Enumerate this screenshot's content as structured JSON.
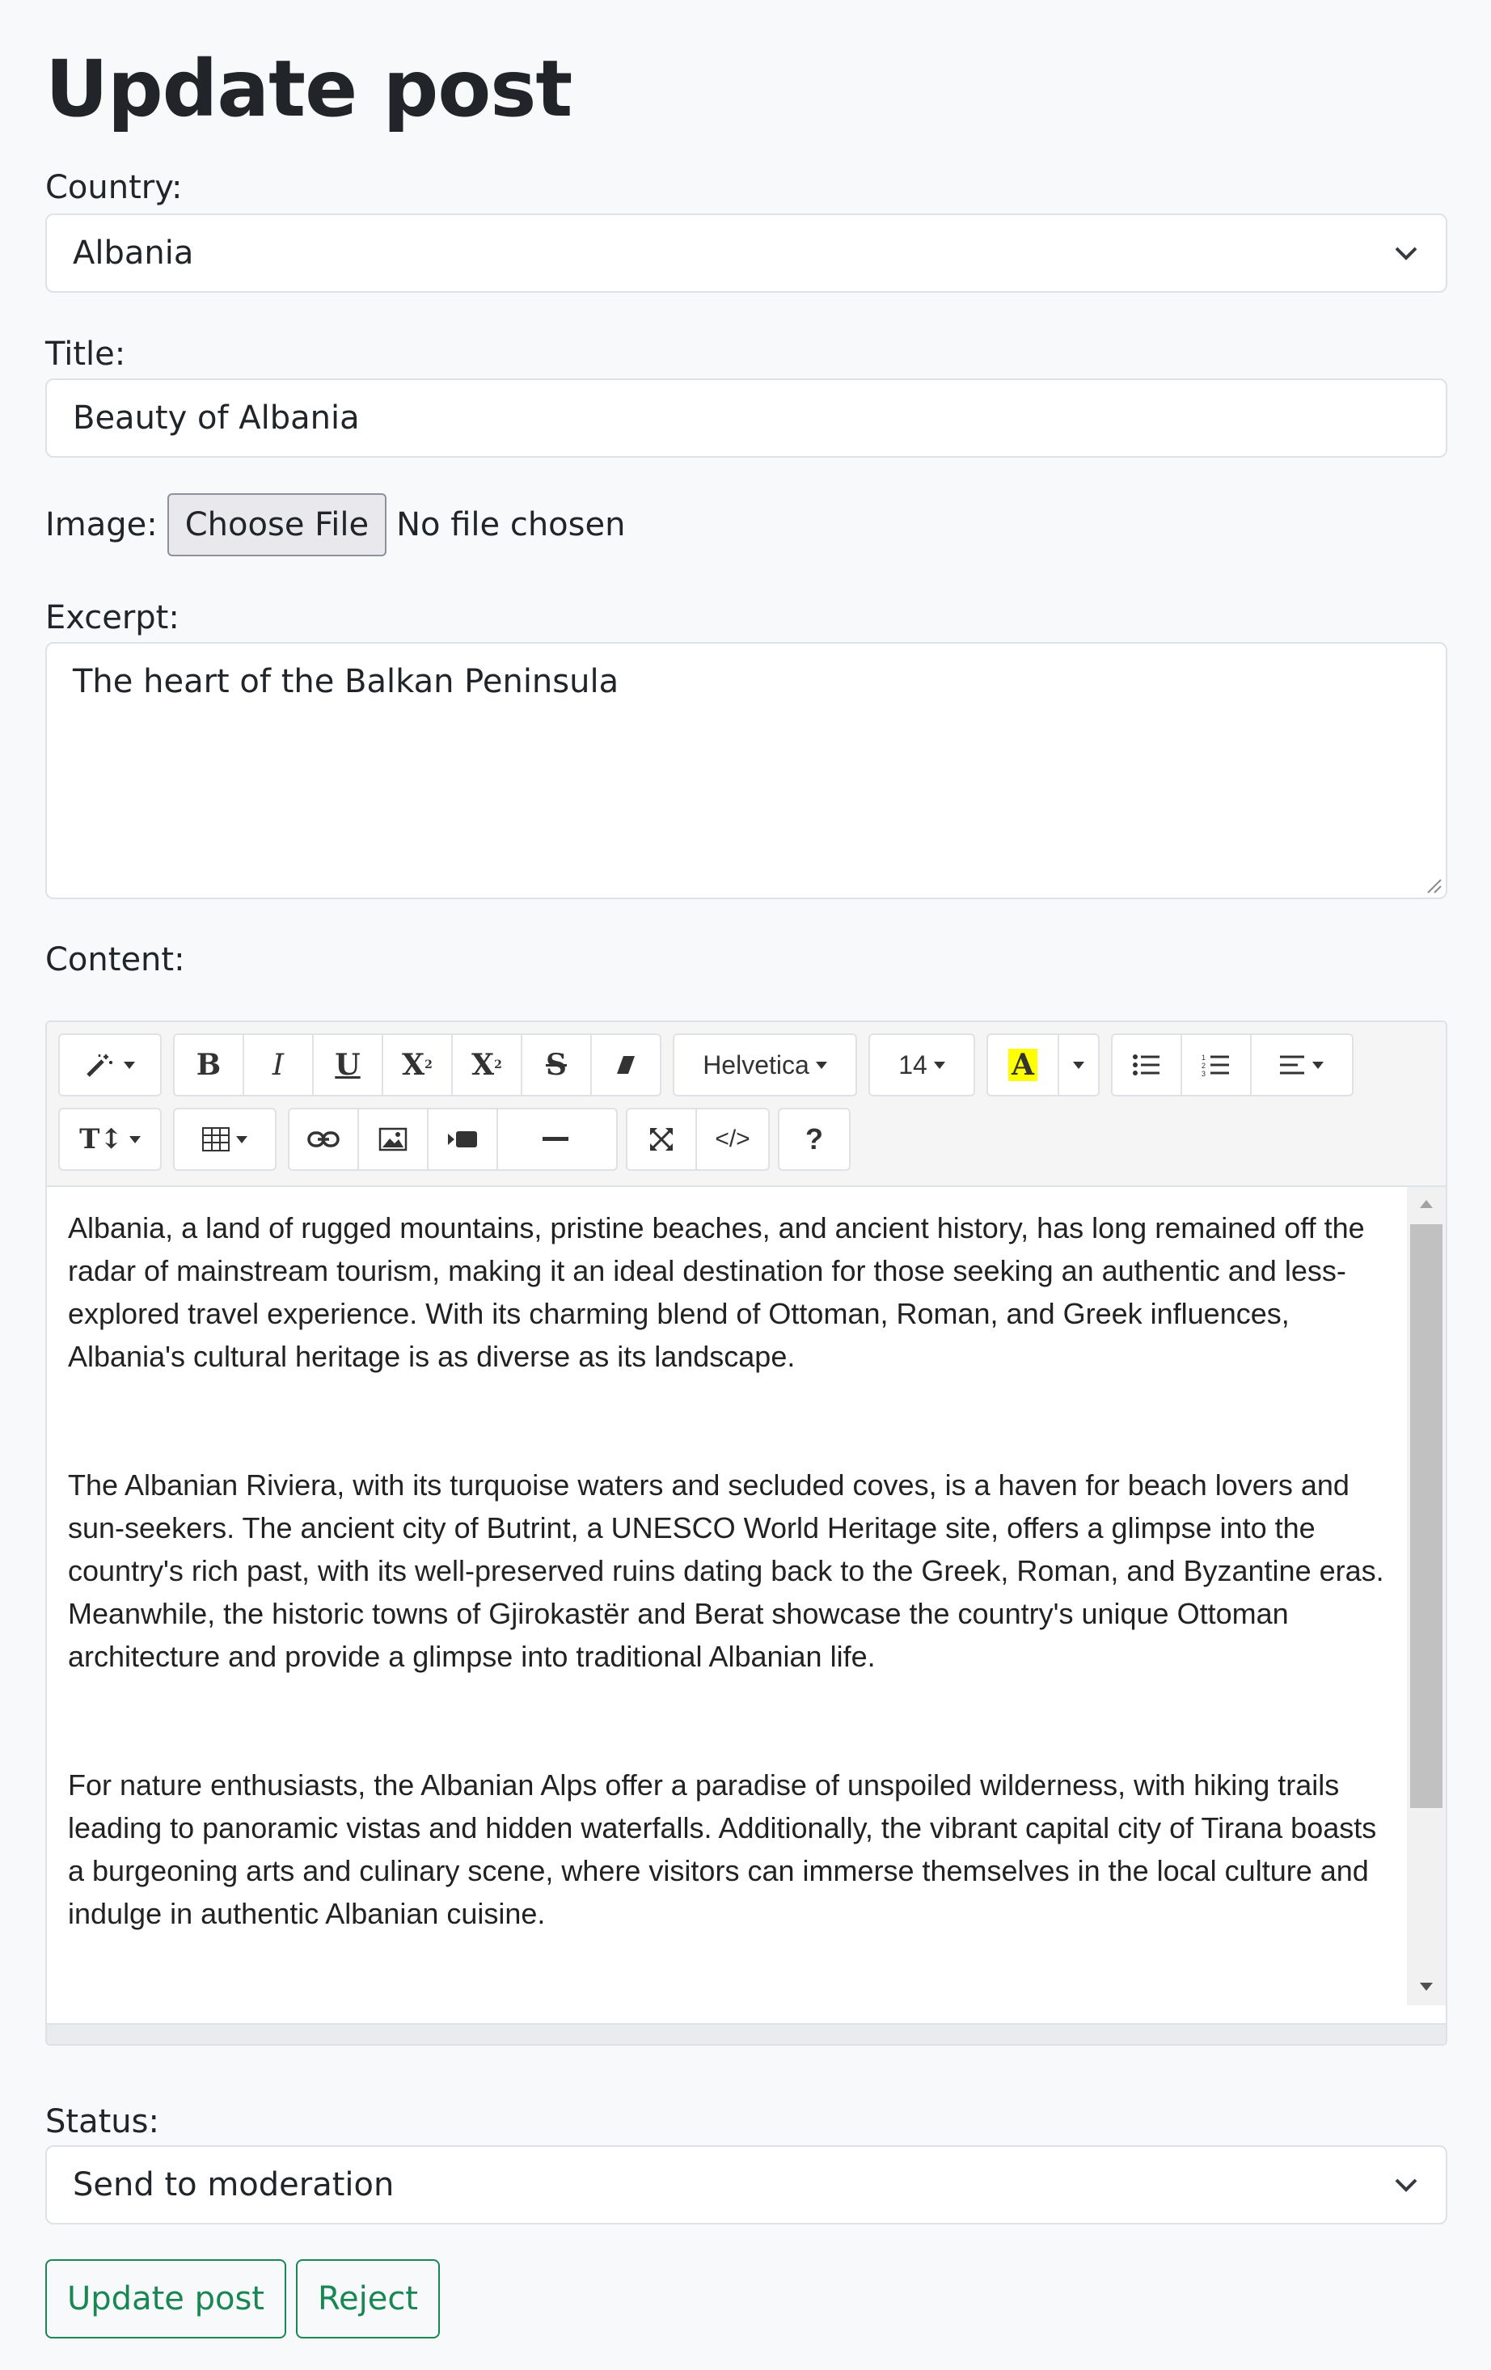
{
  "page": {
    "title": "Update post"
  },
  "country": {
    "label": "Country:",
    "value": "Albania"
  },
  "title_field": {
    "label": "Title:",
    "value": "Beauty of Albania"
  },
  "image": {
    "label": "Image:",
    "button": "Choose File",
    "status": "No file chosen"
  },
  "excerpt": {
    "label": "Excerpt:",
    "value": "The heart of the Balkan Peninsula"
  },
  "content": {
    "label": "Content:",
    "toolbar": {
      "font_name": "Helvetica",
      "font_size": "14",
      "help": "?",
      "code": "</>",
      "highlight_color": "#ffff00"
    },
    "paragraphs": [
      "Albania, a land of rugged mountains, pristine beaches, and ancient history, has long remained off the radar of mainstream tourism, making it an ideal destination for those seeking an authentic and less-explored travel experience. With its charming blend of Ottoman, Roman, and Greek influences, Albania's cultural heritage is as diverse as its landscape.",
      "The Albanian Riviera, with its turquoise waters and secluded coves, is a haven for beach lovers and sun-seekers. The ancient city of Butrint, a UNESCO World Heritage site, offers a glimpse into the country's rich past, with its well-preserved ruins dating back to the Greek, Roman, and Byzantine eras. Meanwhile, the historic towns of Gjirokastër and Berat showcase the country's unique Ottoman architecture and provide a glimpse into traditional Albanian life.",
      "For nature enthusiasts, the Albanian Alps offer a paradise of unspoiled wilderness, with hiking trails leading to panoramic vistas and hidden waterfalls. Additionally, the vibrant capital city of Tirana boasts a burgeoning arts and culinary scene, where visitors can immerse themselves in the local culture and indulge in authentic Albanian cuisine."
    ]
  },
  "status": {
    "label": "Status:",
    "value": "Send to moderation"
  },
  "actions": {
    "update": "Update post",
    "reject": "Reject"
  },
  "colors": {
    "accent": "#198754"
  }
}
